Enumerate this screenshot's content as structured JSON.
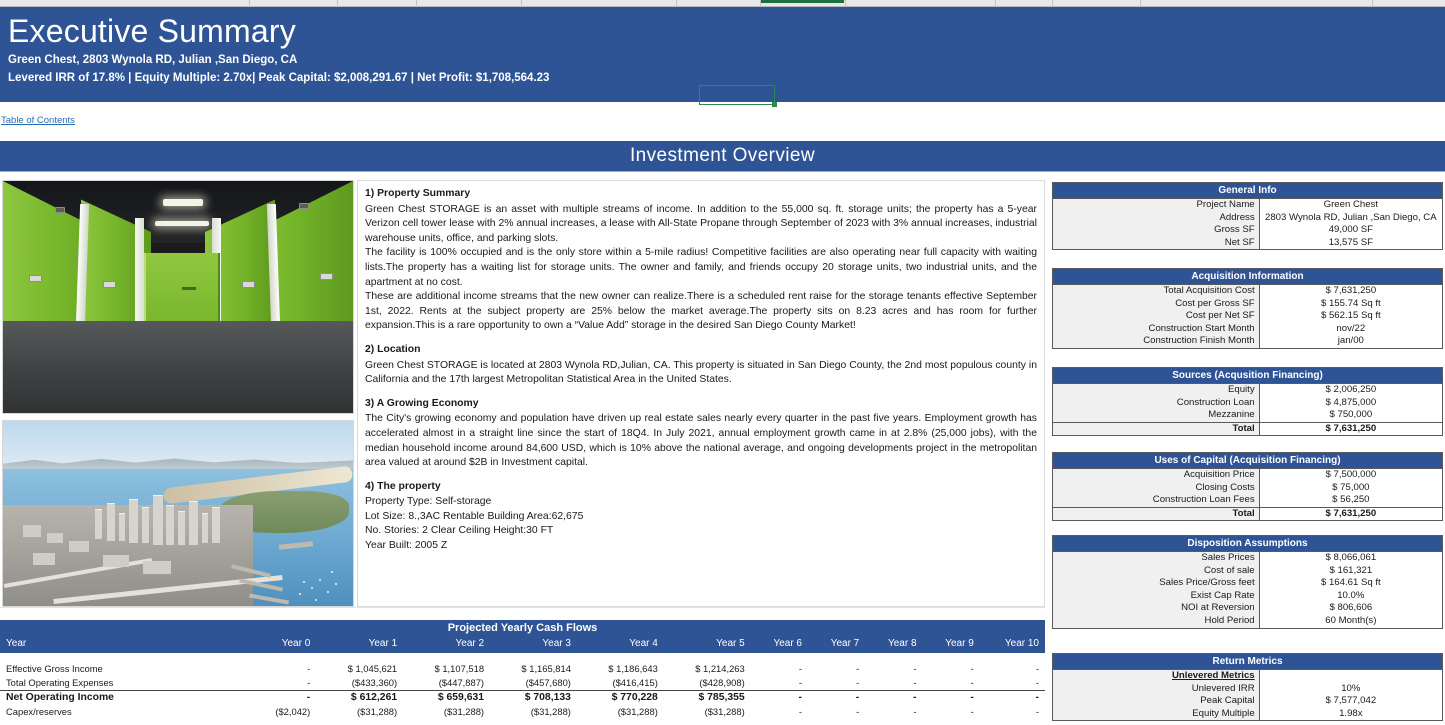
{
  "window": {
    "selected_cell_indicator": "green-selection-box"
  },
  "header": {
    "title": "Executive Summary",
    "address_line": "Green Chest, 2803 Wynola RD, Julian ,San Diego, CA",
    "metrics_line": "Levered IRR of 17.8% | Equity Multiple: 2.70x| Peak Capital: $2,008,291.67 | Net Profit: $1,708,564.23",
    "accent_color": "#2e5496"
  },
  "toc": {
    "label": "Table of Contents"
  },
  "overview": {
    "title": "Investment Overview"
  },
  "images": {
    "storage_alt": "green self-storage corridor",
    "aerial_alt": "aerial view of San Diego bay and downtown"
  },
  "property": {
    "s1_heading": "1) Property Summary",
    "s1_p1": "Green Chest STORAGE is an asset with multiple streams of income. In addition to the 55,000 sq. ft. storage units; the property has a 5-year Verizon cell tower lease with 2% annual increases, a lease with All-State Propane through September of 2023 with 3% annual increases, industrial warehouse units, office, and parking slots.",
    "s1_p2": "The facility is 100% occupied and is the only store within a 5-mile radius! Competitive facilities are also operating near full capacity with waiting lists.The property has a waiting list for storage units. The owner and family, and friends occupy 20 storage units, two industrial units, and the apartment at no cost.",
    "s1_p3": " These are additional income streams that the new owner can realize.There is a scheduled rent raise for the storage tenants effective September 1st, 2022. Rents at the subject property are 25% below the market average.The property sits on 8.23 acres and has room for further expansion.This is a rare opportunity to own a “Value Add” storage in the desired San Diego County Market!",
    "s2_heading": "2) Location",
    "s2_p1": "Green Chest STORAGE is located at 2803 Wynola RD,Julian, CA. This property is situated in San Diego County, the 2nd most populous county in California and the 17th largest Metropolitan Statistical Area in the United States.",
    "s3_heading": "3) A Growing Economy",
    "s3_p1": "The City's growing economy and population have driven up real estate sales nearly every quarter in the past five years. Employment growth has accelerated almost in a straight line since the start of 18Q4. In July 2021, annual employment growth came in at 2.8% (25,000 jobs), with the median household income around 84,600 USD, which is 10% above the national average, and ongoing developments project in the metropolitan area valued at around $2B in Investment capital.",
    "s4_heading": "4) The property",
    "s4_l1": "Property Type: Self-storage",
    "s4_l2": "Lot Size: 8.,3AC          Rentable Building Area:62,675",
    "s4_l3": "No. Stories: 2 Clear Ceiling Height:30 FT",
    "s4_l4": "Year Built: 2005   Z"
  },
  "general_info": {
    "title": "General Info",
    "rows": [
      {
        "k": "Project Name",
        "v": "Green Chest"
      },
      {
        "k": "Address",
        "v": "2803 Wynola RD, Julian ,San Diego, CA"
      },
      {
        "k": "Gross SF",
        "v": "49,000 SF"
      },
      {
        "k": "Net SF",
        "v": "13,575 SF"
      }
    ]
  },
  "acquisition_information": {
    "title": "Acquisition Information",
    "rows": [
      {
        "k": "Total Acquisition Cost",
        "v": "$ 7,631,250"
      },
      {
        "k": "Cost per Gross SF",
        "v": "$ 155.74 Sq ft"
      },
      {
        "k": "Cost per Net SF",
        "v": "$ 562.15 Sq ft"
      },
      {
        "k": "Construction Start Month",
        "v": "nov/22"
      },
      {
        "k": "Construction Finish Month",
        "v": "jan/00"
      }
    ]
  },
  "sources": {
    "title": "Sources (Acqusition Financing)",
    "rows": [
      {
        "k": "Equity",
        "v": "$ 2,006,250"
      },
      {
        "k": "Construction Loan",
        "v": "$ 4,875,000"
      },
      {
        "k": "Mezzanine",
        "v": "$ 750,000"
      }
    ],
    "total_label": "Total",
    "total_value": "$ 7,631,250"
  },
  "uses": {
    "title": "Uses of Capital (Acquisition Financing)",
    "rows": [
      {
        "k": "Acquisition Price",
        "v": "$ 7,500,000"
      },
      {
        "k": "Closing Costs",
        "v": "$ 75,000"
      },
      {
        "k": "Construction Loan Fees",
        "v": "$ 56,250"
      }
    ],
    "total_label": "Total",
    "total_value": "$ 7,631,250"
  },
  "disposition": {
    "title": "Disposition Assumptions",
    "rows": [
      {
        "k": "Sales Prices",
        "v": "$ 8,066,061"
      },
      {
        "k": "Cost of sale",
        "v": "$ 161,321"
      },
      {
        "k": "Sales Price/Gross feet",
        "v": "$ 164.61 Sq ft"
      },
      {
        "k": "Exist Cap Rate",
        "v": "10.0%"
      },
      {
        "k": "NOI at Reversion",
        "v": "$ 806,606"
      },
      {
        "k": "Hold Period",
        "v": "60 Month(s)"
      }
    ]
  },
  "return_metrics": {
    "title": "Return Metrics",
    "subheading": "Unlevered Metrics",
    "rows": [
      {
        "k": "Unlevered IRR",
        "v": "10%"
      },
      {
        "k": "Peak Capital",
        "v": "$ 7,577,042"
      },
      {
        "k": "Equity Multiple",
        "v": "1.98x"
      }
    ]
  },
  "chart_data": {
    "type": "table",
    "title": "Projected Yearly Cash Flows",
    "categories": [
      "Year 0",
      "Year 1",
      "Year 2",
      "Year 3",
      "Year 4",
      "Year 5",
      "Year 6",
      "Year 7",
      "Year 8",
      "Year 9",
      "Year 10"
    ],
    "row_header_label": "Year",
    "series": [
      {
        "name": "Effective Gross Income",
        "values": [
          "-",
          "$ 1,045,621",
          "$ 1,107,518",
          "$ 1,165,814",
          "$ 1,186,643",
          "$ 1,214,263",
          "-",
          "-",
          "-",
          "-",
          "-"
        ]
      },
      {
        "name": "Total Operating Expenses",
        "values": [
          "-",
          "($433,360)",
          "($447,887)",
          "($457,680)",
          "($416,415)",
          "($428,908)",
          "-",
          "-",
          "-",
          "-",
          "-"
        ]
      },
      {
        "name": "Net Operating Income",
        "values": [
          "-",
          "$ 612,261",
          "$ 659,631",
          "$ 708,133",
          "$ 770,228",
          "$ 785,355",
          "-",
          "-",
          "-",
          "-",
          "-"
        ]
      },
      {
        "name": "Capex/reserves",
        "values": [
          "($2,042)",
          "($31,288)",
          "($31,288)",
          "($31,288)",
          "($31,288)",
          "($31,288)",
          "-",
          "-",
          "-",
          "-",
          "-"
        ]
      }
    ]
  }
}
